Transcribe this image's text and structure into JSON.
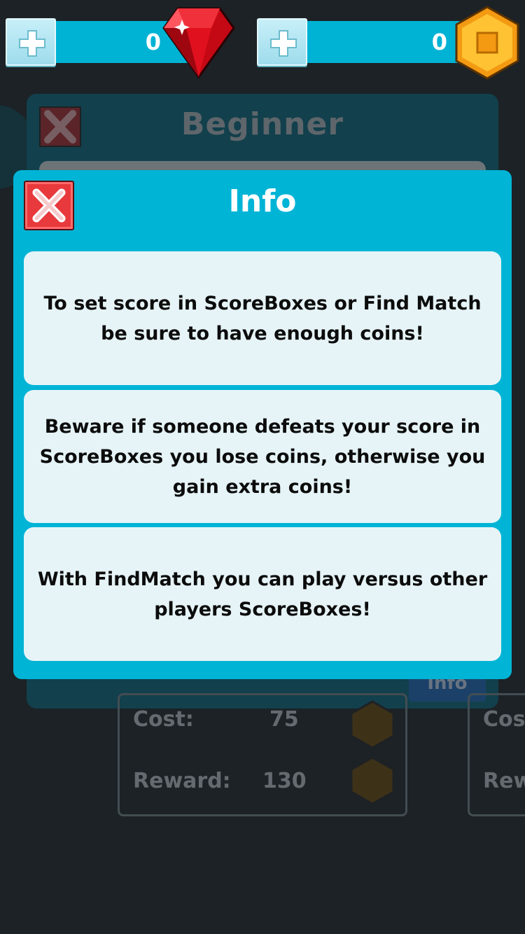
{
  "topbar": {
    "gems": {
      "value": "0",
      "icon": "red-gem-icon"
    },
    "coins": {
      "value": "0",
      "icon": "gold-coin-icon"
    },
    "add_icon": "plus-icon"
  },
  "background_panel": {
    "title": "Beginner",
    "info_button_label": "Info",
    "card": {
      "cost_label": "Cost:",
      "cost_value": "75",
      "reward_label": "Reward:",
      "reward_value": "130"
    },
    "card_right": {
      "cost_label_partial": "Cos",
      "reward_label_partial": "Rew"
    }
  },
  "modal": {
    "title": "Info",
    "messages": [
      "To set score in ScoreBoxes or Find Match be sure to have enough coins!",
      "Beware if someone defeats your score in ScoreBoxes you lose coins, otherwise you gain extra coins!",
      "With FindMatch you can play versus other players ScoreBoxes!"
    ]
  },
  "colors": {
    "accent": "#00b4d6",
    "close_red": "#e8393c",
    "coin_gold": "#f6a51c",
    "gem_red": "#e0101e"
  }
}
